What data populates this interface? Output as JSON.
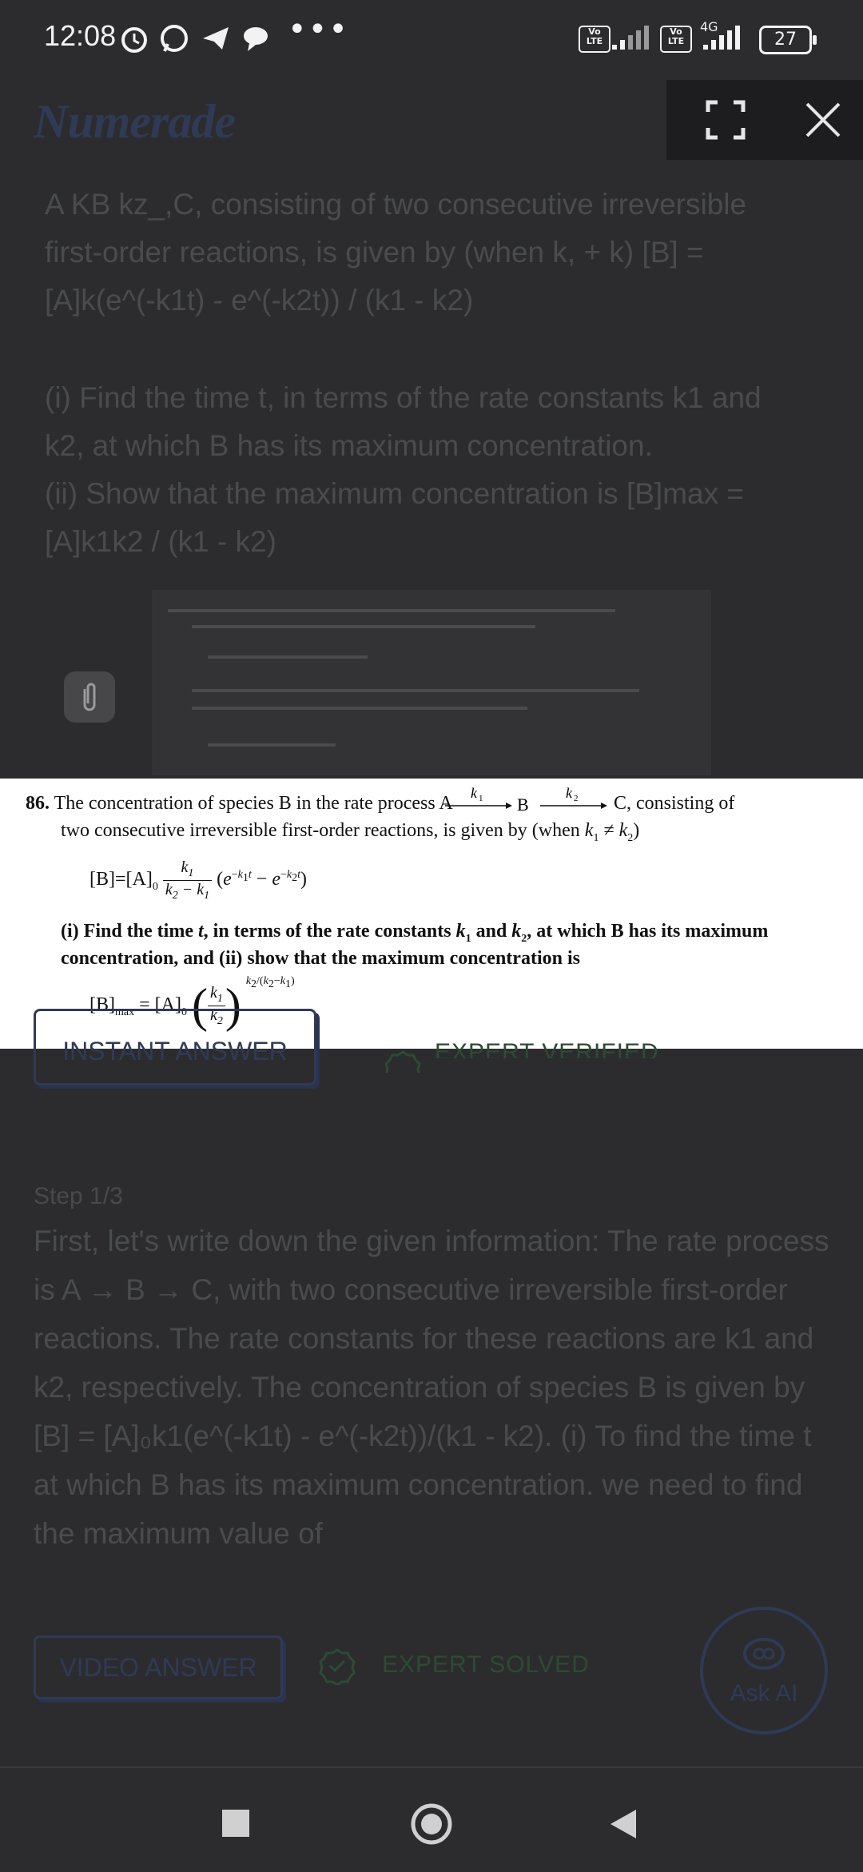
{
  "status_bar": {
    "time": "12:08",
    "more": "•••",
    "lte1": "Vo LTE",
    "lte2": "Vo LTE",
    "network": "4G",
    "battery": "27"
  },
  "header": {
    "logo": "Numerade"
  },
  "question": {
    "line1": "A KB kz_,C, consisting of two consecutive irreversible",
    "line2": "first-order reactions, is given by (when k, + k) [B] =",
    "line3": "[A]k(e^(-k1t) - e^(-k2t)) / (k1 - k2)",
    "line4": "(i) Find the time t, in terms of the rate constants k1 and",
    "line5": "k2, at which B has its maximum concentration.",
    "line6": "(ii) Show that the maximum concentration is [B]max =",
    "line7": "[A]k1k2 / (k1 - k2)"
  },
  "popup": {
    "number": "86.",
    "line1": "The concentration of species B in the rate process A",
    "line1_end": "C, consisting of",
    "line2": "two consecutive irreversible first-order reactions, is given by (when",
    "line3": "(i)  Find the time",
    "line3_b": ", in terms of the rate constants",
    "line3_c": "at which B has its maximum",
    "line4": "concentration, and (ii) show that the maximum concentration is"
  },
  "buttons": {
    "instant_answer": "INSTANT ANSWER",
    "expert_verified": "EXPERT VERIFIED",
    "video_answer": "VIDEO ANSWER",
    "expert_solved": "EXPERT SOLVED",
    "ask_ai": "Ask AI"
  },
  "solution": {
    "step": "Step 1/3",
    "text": "First, let's write down the given information: The rate process is A → B → C, with two consecutive irreversible first-order reactions. The rate constants for these reactions are k1 and k2, respectively. The concentration of species B is given by [B] = [A]₀k1(e^(-k1t) - e^(-k2t))/(k1 - k2). (i) To find the time t at which B has its maximum concentration. we need to find the maximum value of"
  },
  "colors": {
    "background": "#2c2c2e",
    "brand": "#2f3a56",
    "green": "#2c4b34"
  }
}
